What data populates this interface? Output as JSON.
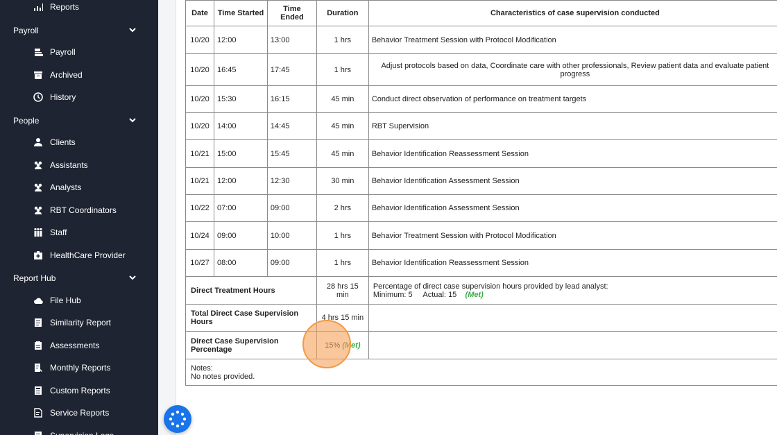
{
  "sidebar": {
    "items": [
      {
        "type": "item",
        "label": "Reports",
        "icon": "chart-icon",
        "name": "sidebar-item-reports"
      },
      {
        "type": "section",
        "label": "Payroll",
        "name": "sidebar-section-payroll"
      },
      {
        "type": "item",
        "label": "Payroll",
        "icon": "payroll-icon",
        "name": "sidebar-item-payroll"
      },
      {
        "type": "item",
        "label": "Archived",
        "icon": "archive-icon",
        "name": "sidebar-item-archived"
      },
      {
        "type": "item",
        "label": "History",
        "icon": "history-icon",
        "name": "sidebar-item-history"
      },
      {
        "type": "section",
        "label": "People",
        "name": "sidebar-section-people"
      },
      {
        "type": "item",
        "label": "Clients",
        "icon": "user-icon",
        "name": "sidebar-item-clients"
      },
      {
        "type": "item",
        "label": "Assistants",
        "icon": "users-icon",
        "name": "sidebar-item-assistants"
      },
      {
        "type": "item",
        "label": "Analysts",
        "icon": "users-icon",
        "name": "sidebar-item-analysts"
      },
      {
        "type": "item",
        "label": "RBT Coordinators",
        "icon": "users-icon",
        "name": "sidebar-item-rbt-coordinators"
      },
      {
        "type": "item",
        "label": "Staff",
        "icon": "staff-icon",
        "name": "sidebar-item-staff"
      },
      {
        "type": "item",
        "label": "HealthCare Provider",
        "icon": "medical-kit-icon",
        "name": "sidebar-item-healthcare-provider"
      },
      {
        "type": "section",
        "label": "Report Hub",
        "name": "sidebar-section-report-hub"
      },
      {
        "type": "item",
        "label": "File Hub",
        "icon": "cloud-icon",
        "name": "sidebar-item-file-hub"
      },
      {
        "type": "item",
        "label": "Similarity Report",
        "icon": "document-icon",
        "name": "sidebar-item-similarity-report"
      },
      {
        "type": "item",
        "label": "Assessments",
        "icon": "clipboard-icon",
        "name": "sidebar-item-assessments"
      },
      {
        "type": "item",
        "label": "Monthly Reports",
        "icon": "report-icon",
        "name": "sidebar-item-monthly-reports"
      },
      {
        "type": "item",
        "label": "Custom Reports",
        "icon": "custom-report-icon",
        "name": "sidebar-item-custom-reports"
      },
      {
        "type": "item",
        "label": "Service Reports",
        "icon": "service-report-icon",
        "name": "sidebar-item-service-reports"
      },
      {
        "type": "item",
        "label": "Supervision Logs",
        "icon": "log-icon",
        "name": "sidebar-item-supervision-logs"
      }
    ]
  },
  "table": {
    "headers": [
      "Date",
      "Time Started",
      "Time Ended",
      "Duration",
      "Characteristics of case supervision conducted"
    ],
    "rows": [
      {
        "date": "10/20",
        "start": "12:00",
        "end": "13:00",
        "duration": "1 hrs",
        "desc": "Behavior Treatment Session with Protocol Modification",
        "center": false
      },
      {
        "date": "10/20",
        "start": "16:45",
        "end": "17:45",
        "duration": "1 hrs",
        "desc": "Adjust protocols based on data, Coordinate care with other professionals, Review patient data and evaluate patient progress",
        "center": true
      },
      {
        "date": "10/20",
        "start": "15:30",
        "end": "16:15",
        "duration": "45 min",
        "desc": "Conduct direct observation of performance on treatment targets",
        "center": false
      },
      {
        "date": "10/20",
        "start": "14:00",
        "end": "14:45",
        "duration": "45 min",
        "desc": "RBT Supervision",
        "center": false
      },
      {
        "date": "10/21",
        "start": "15:00",
        "end": "15:45",
        "duration": "45 min",
        "desc": "Behavior Identification Reassessment Session",
        "center": false
      },
      {
        "date": "10/21",
        "start": "12:00",
        "end": "12:30",
        "duration": "30 min",
        "desc": "Behavior Identification Assessment Session",
        "center": false
      },
      {
        "date": "10/22",
        "start": "07:00",
        "end": "09:00",
        "duration": "2 hrs",
        "desc": "Behavior Identification Assessment Session",
        "center": false
      },
      {
        "date": "10/24",
        "start": "09:00",
        "end": "10:00",
        "duration": "1 hrs",
        "desc": "Behavior Treatment Session with Protocol Modification",
        "center": false
      },
      {
        "date": "10/27",
        "start": "08:00",
        "end": "09:00",
        "duration": "1 hrs",
        "desc": "Behavior Identification Reassessment Session",
        "center": false
      }
    ],
    "summary": {
      "direct_treatment_label": "Direct Treatment Hours",
      "direct_treatment_value": "28 hrs 15 min",
      "lead_pct_label": "Percentage of direct case supervision hours provided by lead analyst:",
      "minimum_label": "Minimum:",
      "minimum_value": "5",
      "actual_label": "Actual:",
      "actual_value": "15",
      "lead_status": "(Met)",
      "total_label": "Total Direct Case Supervision Hours",
      "total_value": "4 hrs 15 min",
      "pct_label": "Direct Case Supervision Percentage",
      "pct_value": "15%",
      "pct_status": "(Met)",
      "notes_label": "Notes:",
      "notes_value": "No notes provided."
    }
  },
  "colors": {
    "sidebar_bg": "#1e2432",
    "met_green": "#3bab4a",
    "fab_blue": "#1a73e8",
    "cursor_orange": "#f09a44"
  }
}
